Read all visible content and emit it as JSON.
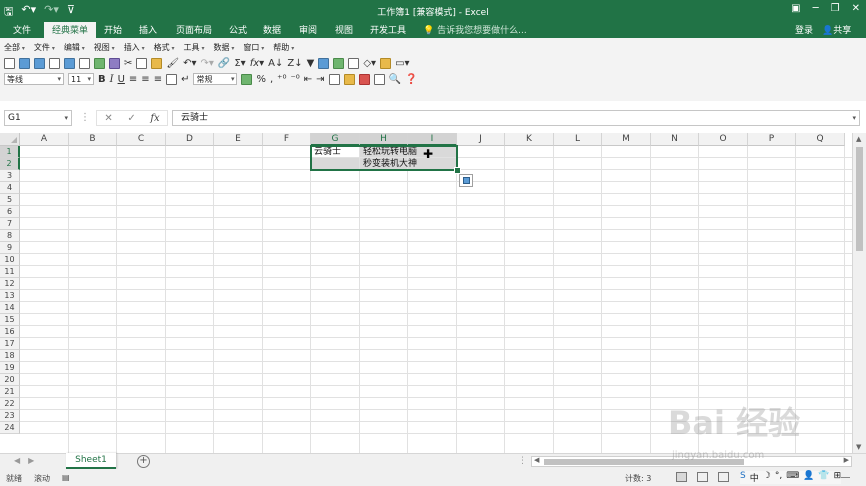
{
  "titlebar": {
    "title": "工作簿1 [兼容模式] - Excel",
    "qat_icons": [
      "save-icon",
      "undo-icon",
      "redo-icon",
      "customize-icon"
    ],
    "window_controls": [
      "ribbon-options-icon",
      "minimize-icon",
      "maximize-icon",
      "close-icon"
    ]
  },
  "tabs": [
    {
      "label": "文件"
    },
    {
      "label": "经典菜单",
      "active": true
    },
    {
      "label": "开始"
    },
    {
      "label": "插入"
    },
    {
      "label": "页面布局"
    },
    {
      "label": "公式"
    },
    {
      "label": "数据"
    },
    {
      "label": "审阅"
    },
    {
      "label": "视图"
    },
    {
      "label": "开发工具"
    }
  ],
  "tell_me": "告诉我您想要做什么...",
  "login": "登录",
  "share": "共享",
  "classic_menu": [
    "全部",
    "文件",
    "编辑",
    "视图",
    "插入",
    "格式",
    "工具",
    "数据",
    "窗口",
    "帮助"
  ],
  "toolbar": {
    "font_name": "等线",
    "font_size": "11",
    "bold": "B",
    "italic": "I",
    "underline": "U",
    "number_format": "常规",
    "percent": "%",
    "comma": ","
  },
  "formula_bar": {
    "name_box": "G1",
    "fx": "fx",
    "content": "云骑士"
  },
  "sheet": {
    "columns": [
      "A",
      "B",
      "C",
      "D",
      "E",
      "F",
      "G",
      "H",
      "I",
      "J",
      "K",
      "L",
      "M",
      "N",
      "O",
      "P",
      "Q"
    ],
    "selected_columns": [
      "G",
      "H",
      "I"
    ],
    "rows": [
      "1",
      "2",
      "3",
      "4",
      "5",
      "6",
      "7",
      "8",
      "9",
      "10",
      "11",
      "12",
      "13",
      "14",
      "15",
      "16",
      "17",
      "18",
      "19",
      "20",
      "21",
      "22",
      "23",
      "24"
    ],
    "selected_rows": [
      "1",
      "2"
    ],
    "cells": {
      "G1": "云骑士",
      "H1": "轻松玩转电脑",
      "H2": "秒变装机大神"
    }
  },
  "sheet_tabs": [
    {
      "label": "Sheet1",
      "active": true
    }
  ],
  "statusbar": {
    "ready": "就绪",
    "scroll": "滚动",
    "count": "计数: 3"
  },
  "watermark": {
    "brand": "Bai 经验",
    "url": "jingyan.baidu.com"
  },
  "ime": {
    "lang": "中"
  },
  "colors": {
    "excel_green": "#217346",
    "selection_fill": "#d9d9d9",
    "ribbon_bg": "#f3f3f3"
  }
}
